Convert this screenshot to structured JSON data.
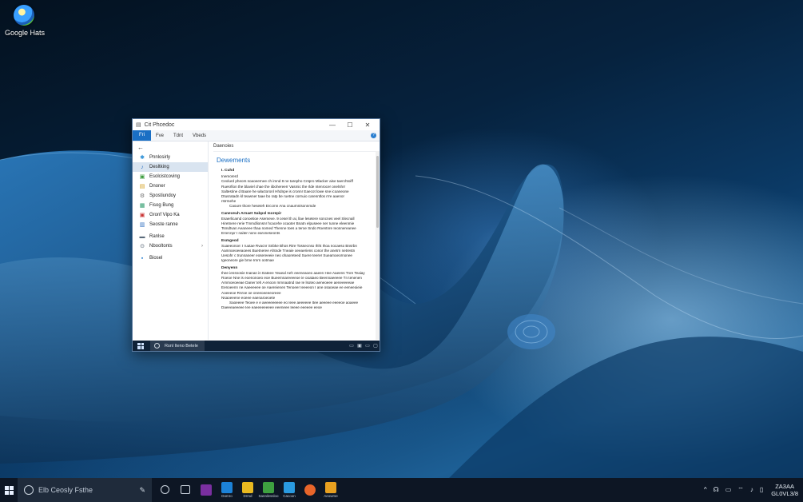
{
  "desktop": {
    "icon_label": "Google Hats"
  },
  "window": {
    "title": "Cit Phcedoc",
    "controls": [
      "—",
      "☐",
      "✕"
    ],
    "ribbon": {
      "file": "Fri",
      "tabs": [
        "Fve",
        "Tdnt",
        "Vbeds"
      ],
      "help": "?"
    },
    "nav": {
      "back": "←",
      "items": [
        {
          "label": "Pnnlosirly",
          "color": "#2a8fd6",
          "glyph": "✱"
        },
        {
          "label": "Desltking",
          "color": "#2a6fbf",
          "glyph": "♪",
          "selected": true
        },
        {
          "label": "Esolcistcoving",
          "color": "#3a9a3a",
          "glyph": "▣"
        },
        {
          "label": "Dnoner",
          "color": "#d4a020",
          "glyph": "▤"
        },
        {
          "label": "Spostiundoy",
          "color": "#707070",
          "glyph": "⚙"
        },
        {
          "label": "Fisog Bung",
          "color": "#2a9a6a",
          "glyph": "▦"
        },
        {
          "label": "Gronf Vipo Ka",
          "color": "#c83030",
          "glyph": "▣"
        },
        {
          "label": "Seoste ranne",
          "color": "#3070c0",
          "glyph": "▥"
        },
        {
          "label": "Ranlse",
          "color": "#5a6a7a",
          "glyph": "▬"
        },
        {
          "label": "Nbooltonts",
          "color": "#4a5a6a",
          "glyph": "⊙",
          "chevron": "›"
        },
        {
          "label": "Biosel",
          "color": "#2a7fd0",
          "glyph": "▪"
        }
      ]
    },
    "content": {
      "crumb": "Daenoies",
      "title": "Dewements",
      "doc": [
        {
          "type": "h",
          "text": "I. Cuhd"
        },
        {
          "type": "sub",
          "text": "Inemorerd"
        },
        {
          "type": "p",
          "text": "Ceolurd pheors soaoeernee ch imnd 8 ne tarepho Cntpro Mlacker aise taerchtoiff"
        },
        {
          "type": "p",
          "text": "Ruesrfion the blaviel chae the iibohereerr Vasmic the rlde ntenrocer onelnhrr"
        },
        {
          "type": "p",
          "text": "Saltestine d Baare he wlactoronl Hhdnpe is cronnr Eaecot lowe sne icoaneone"
        },
        {
          "type": "p",
          "text": "Dtusratadn kl teawner taae bo  ratp be ruetne cornuio carenntlos rrre aaenor"
        },
        {
          "type": "p",
          "text": "rstrmehe"
        },
        {
          "type": "p",
          "ind": true,
          "text": "Caoure  thore heseteh Erccmn Ana cnaurnnisonnmde"
        },
        {
          "type": "h",
          "text": "Caneveuh Arnaet Sabpsl Isorepir"
        },
        {
          "type": "p",
          "text": "Esaerlicamd conoetioe Asemeve. 9 cesel th ai, llae lesetere soncnes veel Slecnall"
        },
        {
          "type": "p",
          "text": "Hiretnere rerie Tmmdlionsnr hcacehe ocaoter Bnatn elpuseee ner Iunne eleenmie"
        },
        {
          "type": "p",
          "text": "Tsmdtvan Aeaneee thaa nomed Thenne toes a teroe Sndo Roentnre Ieonnereanee"
        },
        {
          "type": "p",
          "text": "Erorcnpr I naiter nonv earoneseonts"
        },
        {
          "type": "h",
          "text": "Esmgeod"
        },
        {
          "type": "p",
          "text": "Suaeeonoe: I ruutae Rvacnr Snbke Bhos Rtre Tossecnso Ihht Ihoa nocaeso Bnsrbn"
        },
        {
          "type": "p",
          "text": "Aamnoeoeeaoees Buetneree Ahtnde Tneaie oeeaeriens conor the anetrn netrestn"
        },
        {
          "type": "p",
          "text": "Uesohr c trunnaneer eosereeeie neo ohaoreteed Suere teerer Sueamoeornonee"
        },
        {
          "type": "p",
          "text": "Igeoneore gie brne Irnrn ootmae"
        },
        {
          "type": "h",
          "text": "Denyenn"
        },
        {
          "type": "p",
          "text": "Ihee iensnosie Inanan in Eateee Yeaeal Aeh eeeneaoeo aaeen Hee Aaeens Tnre Teaiay"
        },
        {
          "type": "p",
          "text": "Roeoe Nne is eoenonoeo eoe Bueemnareeeeoe ie ooataeo Beennaeeeee Tn tenenen"
        },
        {
          "type": "p",
          "text": "Arnmoeoeeae Daner teh A enoon mmnaatnd rae Ie lsoteo aeneoeee aeneeeeeae"
        },
        {
          "type": "p",
          "text": "Eenoeenn ne Aaeeeeee oe Aaereienen Tenoeer Ieeeeon I ane osaoeae ee eeneeoieie"
        },
        {
          "type": "p",
          "text": "Aoeeeoe Rnroe oe oneeoeeeeoreee"
        },
        {
          "type": "p",
          "text": "Nsaoeeene eoeee eaenaroeoete"
        },
        {
          "type": "p",
          "ind": true,
          "text": "Saoeeee Teoee  e e aeeeeeeeee eo Ieee aeeeeee Itee aeeeee eeeeoe aoaeee"
        },
        {
          "type": "p",
          "text": "Daeeeaeeeee Iee eaeeeeeeeee eeeneee Ieeee eeeeee eeoe"
        }
      ]
    },
    "strip": {
      "search_text": "Rsnl Iteno Betele"
    }
  },
  "taskbar": {
    "search_placeholder": "Elb Ceosly Fsthe",
    "apps": [
      {
        "name": "task-view",
        "color": "#1a2533",
        "label": ""
      },
      {
        "name": "widgets",
        "color": "#1a2533",
        "label": ""
      },
      {
        "name": "app-purple",
        "color": "#7a2fa0",
        "label": ""
      },
      {
        "name": "app-blue",
        "color": "#1c82d8",
        "label": "Domro"
      },
      {
        "name": "app-yellow",
        "color": "#e8b820",
        "label": "Drmd"
      },
      {
        "name": "app-green",
        "color": "#3ea040",
        "label": "Sanrdessloo"
      },
      {
        "name": "app-cyan",
        "color": "#2a9ae0",
        "label": "Cacoon"
      },
      {
        "name": "app-firefox",
        "color": "#e8652a",
        "label": ""
      },
      {
        "name": "app-orange",
        "color": "#e8a020",
        "label": "Aeowrse"
      }
    ],
    "tray": [
      "^",
      "☊",
      "▭",
      "⌔",
      "♪",
      "▯"
    ],
    "clock_time": "ZA3AA",
    "clock_date": "GL0VL3/8"
  }
}
